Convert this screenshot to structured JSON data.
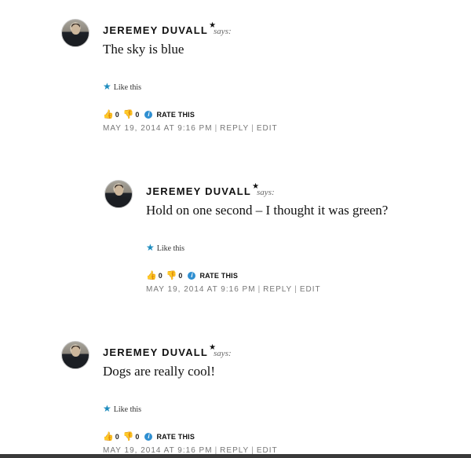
{
  "comments": [
    {
      "author": "JEREMEY DUVALL",
      "star": "★",
      "says": "says:",
      "text": "The sky is blue",
      "like_star": "★",
      "like_label": "Like this",
      "up_count": "0",
      "down_count": "0",
      "rate_label": "RATE THIS",
      "date": "MAY 19, 2014 AT 9:16 PM",
      "reply_label": "REPLY",
      "edit_label": "EDIT"
    },
    {
      "author": "JEREMEY DUVALL",
      "star": "★",
      "says": "says:",
      "text": "Hold on one second – I thought it was green?",
      "like_star": "★",
      "like_label": "Like this",
      "up_count": "0",
      "down_count": "0",
      "rate_label": "RATE THIS",
      "date": "MAY 19, 2014 AT 9:16 PM",
      "reply_label": "REPLY",
      "edit_label": "EDIT"
    },
    {
      "author": "JEREMEY DUVALL",
      "star": "★",
      "says": "says:",
      "text": "Dogs are really cool!",
      "like_star": "★",
      "like_label": "Like this",
      "up_count": "0",
      "down_count": "0",
      "rate_label": "RATE THIS",
      "date": "MAY 19, 2014 AT 9:16 PM",
      "reply_label": "REPLY",
      "edit_label": "EDIT"
    }
  ],
  "icons": {
    "thumb_up": "thumbs-up-icon",
    "thumb_down": "thumbs-down-icon",
    "info": "info-icon",
    "like_star": "star-icon"
  },
  "colors": {
    "accent_blue": "#1e8cbe",
    "meta_gray": "#777777"
  }
}
